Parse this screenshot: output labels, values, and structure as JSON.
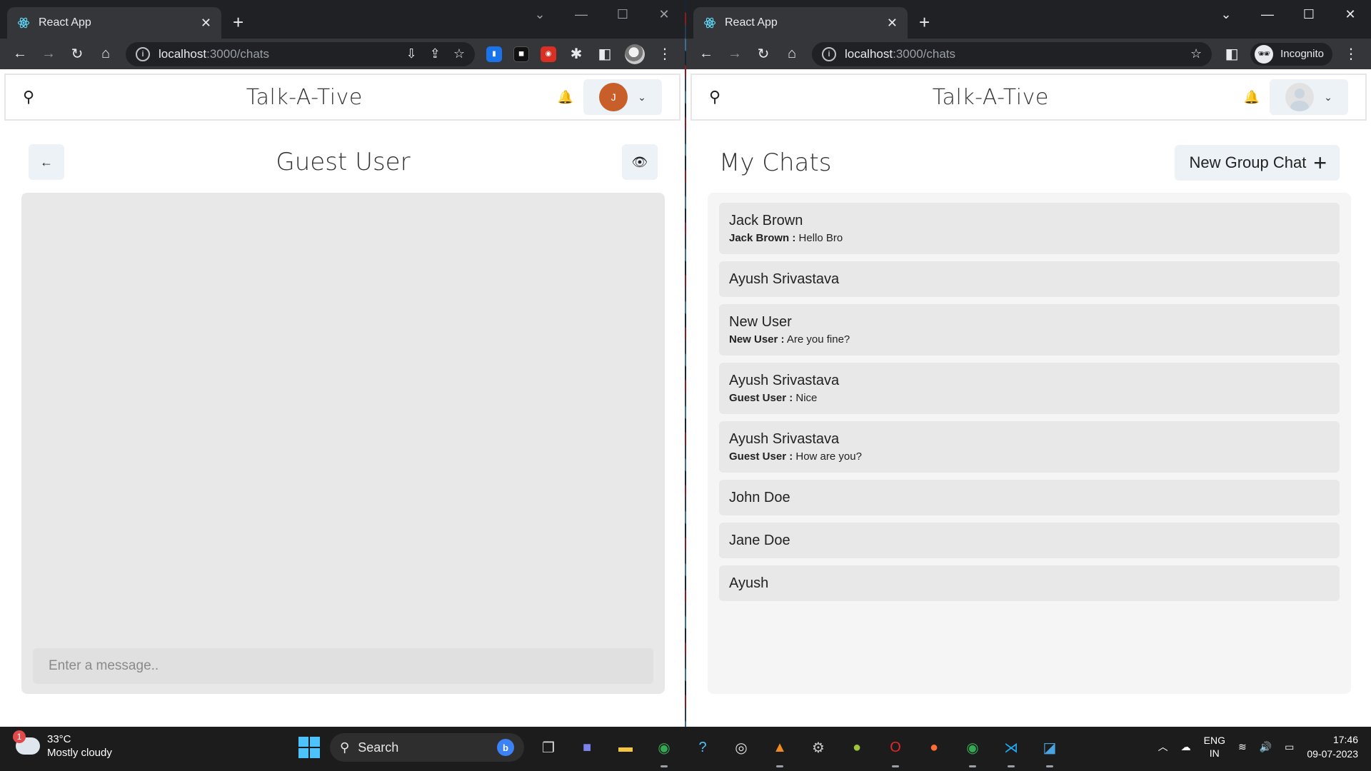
{
  "browser_left": {
    "tab_title": "React App",
    "url_host": "localhost",
    "url_path": ":3000/chats"
  },
  "browser_right": {
    "tab_title": "React App",
    "url_host": "localhost",
    "url_path": ":3000/chats",
    "incognito_label": "Incognito"
  },
  "app": {
    "brand": "Talk-A-Tive"
  },
  "left_user": {
    "avatar_initial": "J"
  },
  "chat_view": {
    "title": "Guest User",
    "input_placeholder": "Enter a message.."
  },
  "my_chats": {
    "title": "My Chats",
    "new_group_label": "New Group Chat",
    "items": [
      {
        "name": "Jack Brown",
        "sender": "Jack Brown :",
        "message": "Hello Bro"
      },
      {
        "name": "Ayush Srivastava",
        "sender": "",
        "message": ""
      },
      {
        "name": "New User",
        "sender": "New User :",
        "message": "Are you fine?"
      },
      {
        "name": "Ayush Srivastava",
        "sender": "Guest User :",
        "message": "Nice"
      },
      {
        "name": "Ayush Srivastava",
        "sender": "Guest User :",
        "message": "How are you?"
      },
      {
        "name": "John Doe",
        "sender": "",
        "message": ""
      },
      {
        "name": "Jane Doe",
        "sender": "",
        "message": ""
      },
      {
        "name": "Ayush",
        "sender": "",
        "message": ""
      }
    ]
  },
  "taskbar": {
    "weather_temp": "33°C",
    "weather_desc": "Mostly cloudy",
    "notification_count": "1",
    "search_label": "Search",
    "lang_top": "ENG",
    "lang_bottom": "IN",
    "time": "17:46",
    "date": "09-07-2023"
  },
  "colors": {
    "avatar_orange": "#c85f2a",
    "button_bg": "#edf2f7",
    "chat_item_bg": "#e8e8e8"
  }
}
